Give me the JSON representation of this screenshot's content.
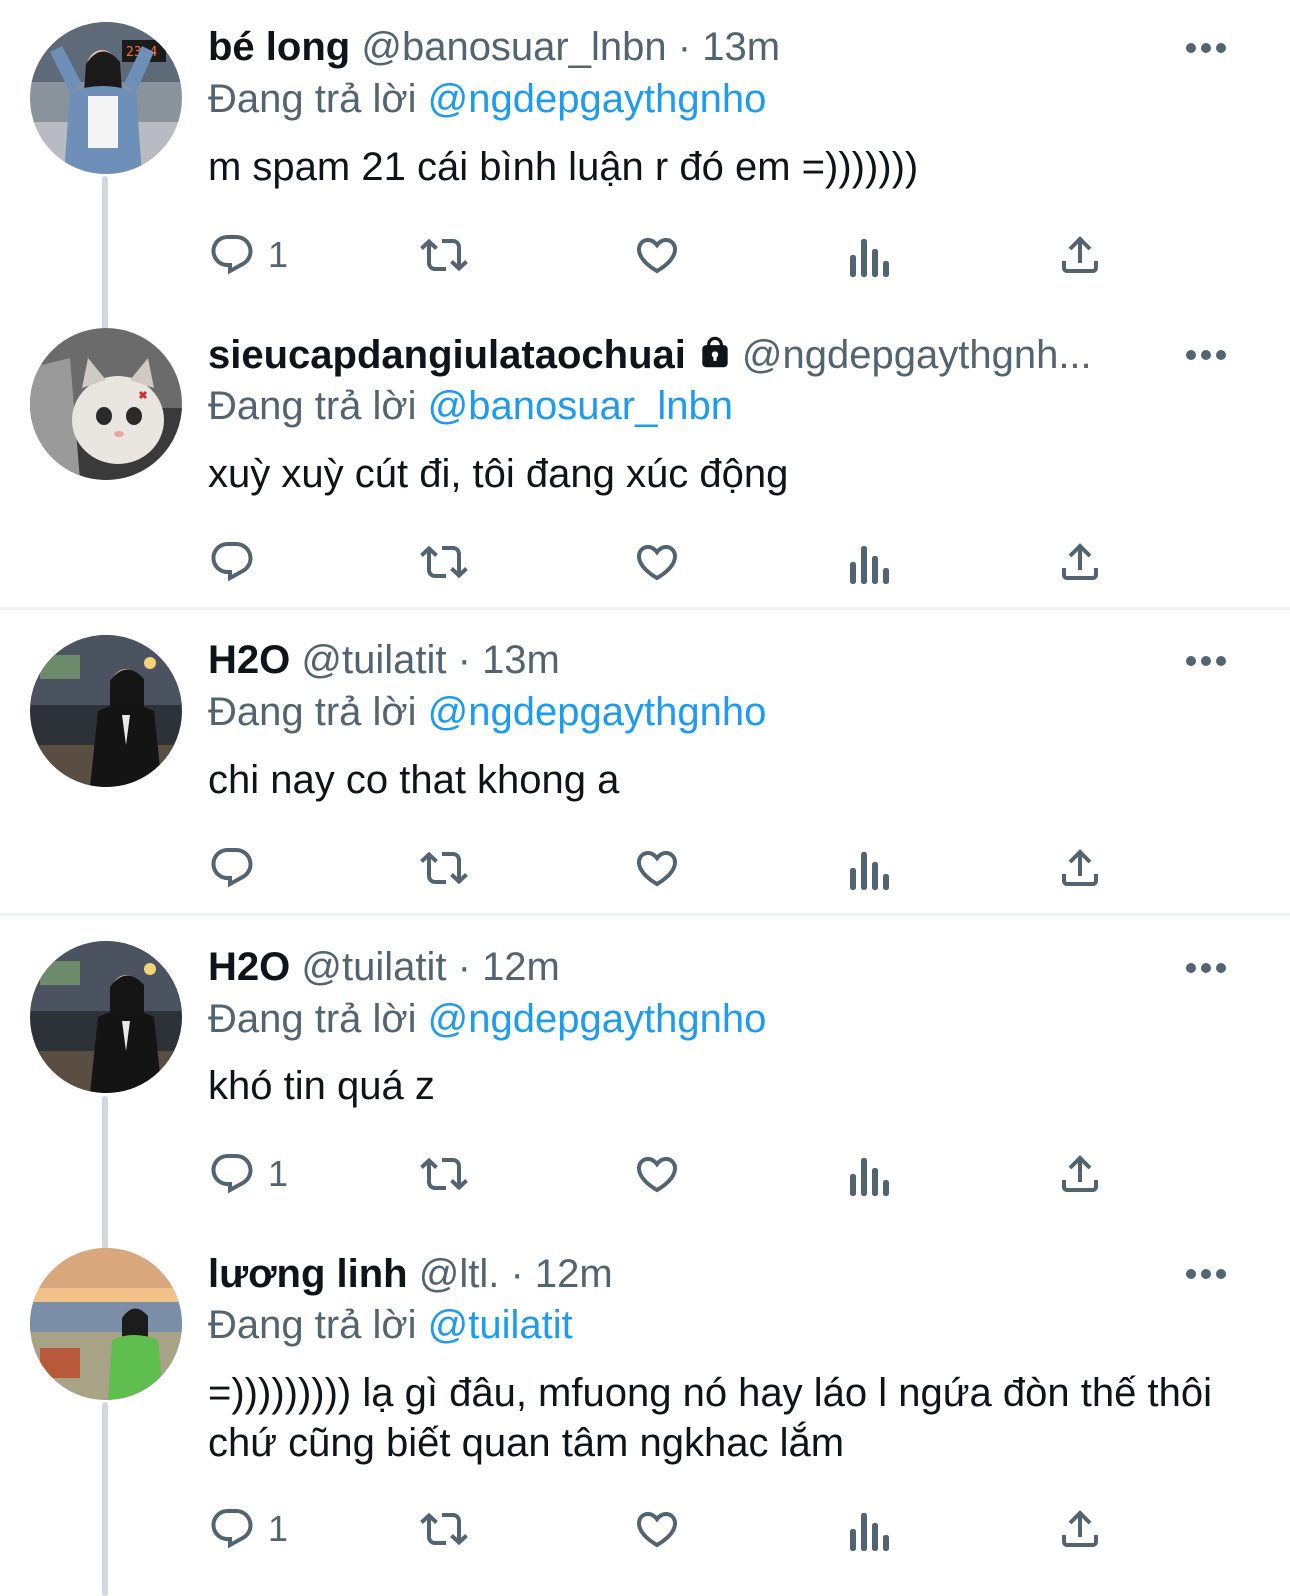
{
  "tweets": [
    {
      "name": "bé long",
      "handle": "@banosuar_lnbn",
      "separator": "·",
      "time": "13m",
      "reply_prefix": "Đang trả lời",
      "reply_to": "@ngdepgaythgnho",
      "text": "m spam 21 cái bình luận r đó em =)))))))",
      "reply_count": "1",
      "avatar_icon": "avatar-photo"
    },
    {
      "name": "sieucapdangiulataochuai",
      "protected_icon": "lock-icon",
      "handle": "@ngdepgaythgnh...",
      "reply_prefix": "Đang trả lời",
      "reply_to": "@banosuar_lnbn",
      "text": "xuỳ xuỳ cút đi, tôi đang xúc động",
      "reply_count": "",
      "avatar_icon": "cat-photo"
    },
    {
      "name": "H2O",
      "handle": "@tuilatit",
      "separator": "·",
      "time": "13m",
      "reply_prefix": "Đang trả lời",
      "reply_to": "@ngdepgaythgnho",
      "text": "chi nay co that khong a",
      "reply_count": "",
      "avatar_icon": "avatar-photo"
    },
    {
      "name": "H2O",
      "handle": "@tuilatit",
      "separator": "·",
      "time": "12m",
      "reply_prefix": "Đang trả lời",
      "reply_to": "@ngdepgaythgnho",
      "text": "khó tin quá z",
      "reply_count": "1",
      "avatar_icon": "avatar-photo"
    },
    {
      "name": "lương linh",
      "handle": "@ltl.",
      "separator": "·",
      "time": "12m",
      "reply_prefix": "Đang trả lời",
      "reply_to": "@tuilatit",
      "text": "=))))))))) lạ gì đâu, mfuong nó hay láo l ngứa đòn thế thôi chứ cũng biết quan tâm ngkhac lắm",
      "reply_count": "1",
      "avatar_icon": "avatar-photo"
    }
  ],
  "action_icons": [
    "reply-icon",
    "retweet-icon",
    "like-icon",
    "views-icon",
    "share-icon"
  ],
  "colors": {
    "text": "#0f1419",
    "secondary": "#536471",
    "link": "#1d9bf0",
    "thread_line": "#cfd9de",
    "divider": "#eff3f4"
  }
}
